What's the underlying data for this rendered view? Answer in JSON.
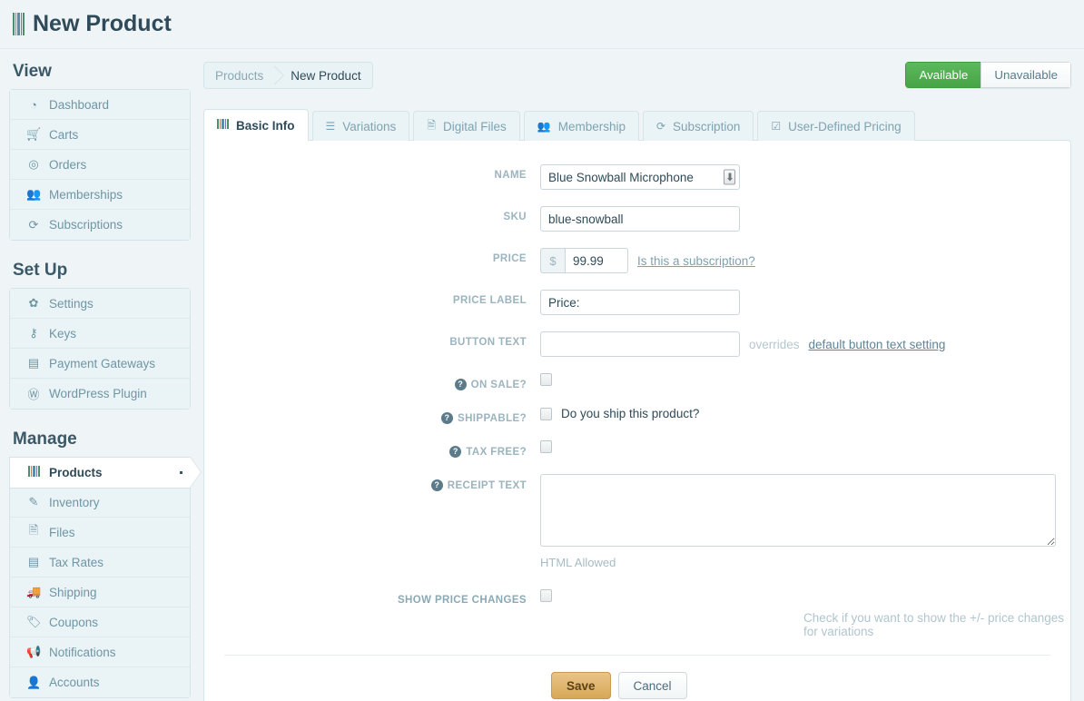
{
  "page": {
    "title": "New Product",
    "title_icon": "barcode-icon"
  },
  "sidebar": {
    "sections": [
      {
        "heading": "View",
        "items": [
          {
            "label": "Dashboard",
            "icon": "dashboard-icon",
            "glyph": "◔",
            "active": false
          },
          {
            "label": "Carts",
            "icon": "cart-icon",
            "glyph": "🛒",
            "active": false
          },
          {
            "label": "Orders",
            "icon": "orders-icon",
            "glyph": "◎",
            "active": false
          },
          {
            "label": "Memberships",
            "icon": "memberships-icon",
            "glyph": "👥",
            "active": false
          },
          {
            "label": "Subscriptions",
            "icon": "refresh-icon",
            "glyph": "⟳",
            "active": false
          }
        ]
      },
      {
        "heading": "Set Up",
        "items": [
          {
            "label": "Settings",
            "icon": "gear-icon",
            "glyph": "✿",
            "active": false
          },
          {
            "label": "Keys",
            "icon": "key-icon",
            "glyph": "⚷",
            "active": false
          },
          {
            "label": "Payment Gateways",
            "icon": "credit-card-icon",
            "glyph": "▤",
            "active": false
          },
          {
            "label": "WordPress Plugin",
            "icon": "wordpress-icon",
            "glyph": "Ⓦ",
            "active": false
          }
        ]
      },
      {
        "heading": "Manage",
        "items": [
          {
            "label": "Products",
            "icon": "barcode-icon",
            "glyph": "",
            "active": true
          },
          {
            "label": "Inventory",
            "icon": "pencil-icon",
            "glyph": "✎",
            "active": false
          },
          {
            "label": "Files",
            "icon": "file-icon",
            "glyph": "🗎",
            "active": false
          },
          {
            "label": "Tax Rates",
            "icon": "book-icon",
            "glyph": "▤",
            "active": false
          },
          {
            "label": "Shipping",
            "icon": "truck-icon",
            "glyph": "🚚",
            "active": false
          },
          {
            "label": "Coupons",
            "icon": "tag-icon",
            "glyph": "🏷",
            "active": false
          },
          {
            "label": "Notifications",
            "icon": "megaphone-icon",
            "glyph": "📢",
            "active": false
          },
          {
            "label": "Accounts",
            "icon": "user-icon",
            "glyph": "👤",
            "active": false
          }
        ]
      }
    ]
  },
  "breadcrumb": {
    "parent": "Products",
    "current": "New Product"
  },
  "availability": {
    "available_label": "Available",
    "unavailable_label": "Unavailable",
    "selected": "Available",
    "active_color": "#46a546"
  },
  "tabs": [
    {
      "label": "Basic Info",
      "icon": "barcode-icon",
      "glyph": "",
      "active": true
    },
    {
      "label": "Variations",
      "icon": "list-icon",
      "glyph": "☰",
      "active": false
    },
    {
      "label": "Digital Files",
      "icon": "file-icon",
      "glyph": "🗎",
      "active": false
    },
    {
      "label": "Membership",
      "icon": "group-icon",
      "glyph": "👥",
      "active": false
    },
    {
      "label": "Subscription",
      "icon": "refresh-icon",
      "glyph": "⟳",
      "active": false
    },
    {
      "label": "User-Defined Pricing",
      "icon": "edit-square-icon",
      "glyph": "☑",
      "active": false
    }
  ],
  "form": {
    "name": {
      "label": "NAME",
      "value": "Blue Snowball Microphone",
      "placeholder": "",
      "autofill_icon": "autofill-icon"
    },
    "sku": {
      "label": "SKU",
      "value": "blue-snowball",
      "placeholder": ""
    },
    "price": {
      "label": "PRICE",
      "currency_symbol": "$",
      "value": "99.99",
      "placeholder": "",
      "subscription_link": "Is this a subscription?"
    },
    "price_label": {
      "label": "PRICE LABEL",
      "value": "Price:",
      "placeholder": ""
    },
    "button_text": {
      "label": "BUTTON TEXT",
      "value": "",
      "placeholder": "",
      "note_prefix": "overrides",
      "note_link": "default button text setting"
    },
    "on_sale": {
      "label": "ON SALE?",
      "checked": false,
      "help": "?"
    },
    "shippable": {
      "label": "SHIPPABLE?",
      "checked": false,
      "help": "?",
      "checkbox_text": "Do you ship this product?"
    },
    "tax_free": {
      "label": "TAX FREE?",
      "checked": false,
      "help": "?"
    },
    "receipt_text": {
      "label": "RECEIPT TEXT",
      "value": "",
      "placeholder": "",
      "help": "?",
      "hint": "HTML Allowed"
    },
    "show_price_changes": {
      "label": "SHOW PRICE CHANGES",
      "checked": false,
      "note": "Check if you want to show the +/- price changes for variations"
    }
  },
  "actions": {
    "save_label": "Save",
    "cancel_label": "Cancel",
    "save_color": "#d7a857"
  }
}
